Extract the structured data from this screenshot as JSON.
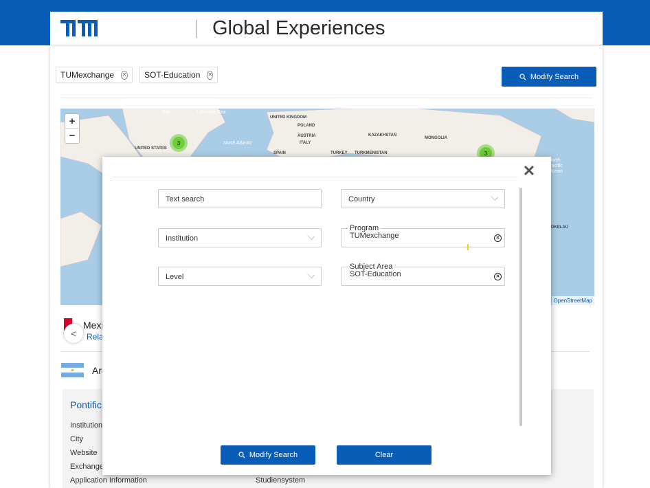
{
  "header": {
    "title": "Global Experiences",
    "logo_text": "TUM"
  },
  "filters": {
    "chips": [
      {
        "label": "TUMexchange"
      },
      {
        "label": "SOT-Education"
      }
    ],
    "modify_button": "Modify Search"
  },
  "map": {
    "zoom_in": "+",
    "zoom_out": "−",
    "labels": {
      "united_kingdom": "UNITED KINGDOM",
      "poland": "POLAND",
      "austria": "AUSTRIA",
      "italy": "ITALY",
      "spain": "SPAIN",
      "turkey": "TURKEY",
      "turkmenistan": "TURKMENISTAN",
      "kazakhstan": "KAZAKHSTAN",
      "mongolia": "MONGOLIA",
      "united_states": "UNITED STATES",
      "tokelau": "TOKELAU",
      "north_atlantic": "North Atlantic",
      "north_pacific": "North Pacific Ocean",
      "bay": "Bay",
      "labrador": "Labrador Sea"
    },
    "clusters": [
      {
        "count": "3"
      },
      {
        "count": "3"
      }
    ],
    "attribution": "OpenStreetMap"
  },
  "results": [
    {
      "country": "Mexico",
      "link": "Relations"
    },
    {
      "country": "Argentina"
    }
  ],
  "card": {
    "title": "Pontificia",
    "rows": [
      {
        "label": "Institution"
      },
      {
        "label": "City"
      },
      {
        "label": "Website"
      },
      {
        "label": "Exchange"
      },
      {
        "label": "Application Information",
        "value": "Studiensystem"
      }
    ]
  },
  "modal": {
    "close": "✕",
    "fields": {
      "text_search": {
        "placeholder": "Text search"
      },
      "country": {
        "placeholder": "Country"
      },
      "institution": {
        "placeholder": "Institution"
      },
      "program": {
        "label": "Program",
        "value": "TUMexchange"
      },
      "level": {
        "placeholder": "Level"
      },
      "subject_area": {
        "label": "Subject Area",
        "value": "SOT-Education"
      }
    },
    "modify_button": "Modify Search",
    "clear_button": "Clear"
  },
  "colors": {
    "brand_blue": "#0a5db6",
    "cluster_green": "#6ecc39",
    "map_water": "#a9cde6",
    "flag_red": "#d6002a"
  },
  "icons": {
    "search": "search-icon",
    "chip_remove": "circle-x-icon",
    "close": "close-icon",
    "chevron": "chevron-down-icon"
  }
}
